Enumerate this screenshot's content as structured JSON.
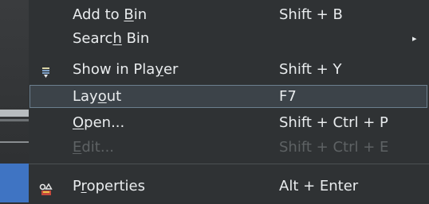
{
  "menu": {
    "items": [
      {
        "pre": "Add to ",
        "u": "B",
        "post": "in",
        "shortcut": "Shift + B"
      },
      {
        "pre": "Searc",
        "u": "h",
        "post": " Bin",
        "shortcut": "",
        "arrow": "▸"
      },
      {
        "pre": "Show in Pla",
        "u": "y",
        "post": "er",
        "shortcut": "Shift + Y",
        "icon": "player-icon"
      },
      {
        "pre": "Lay",
        "u": "o",
        "post": "ut",
        "shortcut": "F7"
      },
      {
        "pre": "",
        "u": "O",
        "post": "pen...",
        "shortcut": "Shift + Ctrl + P"
      },
      {
        "pre": "",
        "u": "E",
        "post": "dit...",
        "shortcut": "Shift + Ctrl + E"
      },
      {
        "pre": "P",
        "u": "r",
        "post": "operties",
        "shortcut": "Alt + Enter",
        "icon": "properties-icon"
      }
    ]
  },
  "colors": {
    "menu_bg": "#2f3234",
    "text": "#e9ecee",
    "disabled_text": "#5e6264",
    "highlight_bg": "#3c4349",
    "highlight_border": "#6c7f8e",
    "accent_blue": "#3f74c3"
  }
}
